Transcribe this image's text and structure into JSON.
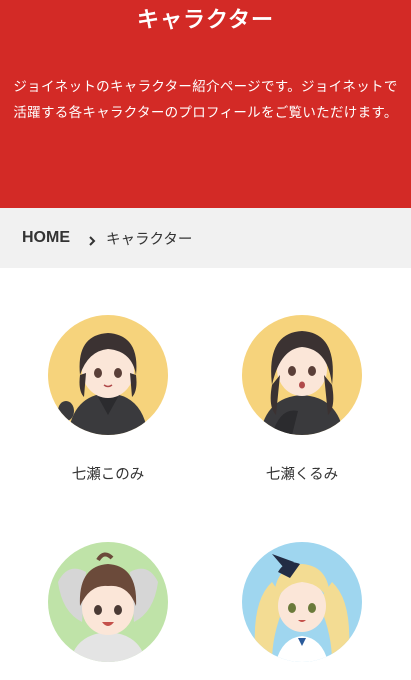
{
  "hero": {
    "title": "キャラクター",
    "description": "ジョイネットのキャラクター紹介ページです。ジョイネットで活躍する各キャラクターのプロフィールをご覧いただけます。"
  },
  "breadcrumb": {
    "home": "HOME",
    "current": "キャラクター"
  },
  "characters": [
    {
      "name": "七瀬このみ",
      "icon": "character-konomi-avatar",
      "bg": "#f6d37c"
    },
    {
      "name": "七瀬くるみ",
      "icon": "character-kurumi-avatar",
      "bg": "#f6d37c"
    },
    {
      "name": "",
      "icon": "character-boy-avatar",
      "bg": "#bfe3a8"
    },
    {
      "name": "",
      "icon": "character-blonde-avatar",
      "bg": "#9fd6ef"
    }
  ],
  "colors": {
    "brand_red": "#d32a26",
    "breadcrumb_bg": "#f1f1f1"
  }
}
